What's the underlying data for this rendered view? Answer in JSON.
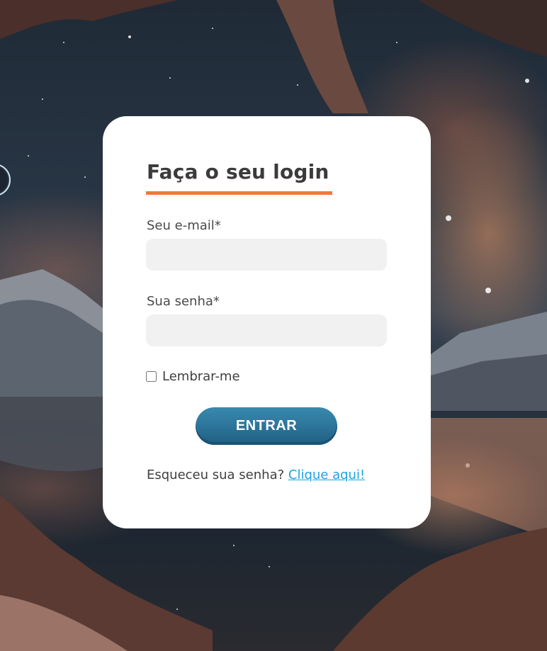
{
  "login": {
    "title": "Faça o seu login",
    "email_label": "Seu e-mail*",
    "email_value": "",
    "password_label": "Sua senha*",
    "password_value": "",
    "remember_label": "Lembrar-me",
    "remember_checked": false,
    "submit_label": "ENTRAR",
    "forgot_text": "Esqueceu sua senha?",
    "forgot_link": "Clique aqui!"
  },
  "colors": {
    "accent_underline": "#f07a3c",
    "button": "#2c7399",
    "link": "#1fa2e0",
    "card": "#ffffff",
    "field": "#f1f1f1"
  }
}
